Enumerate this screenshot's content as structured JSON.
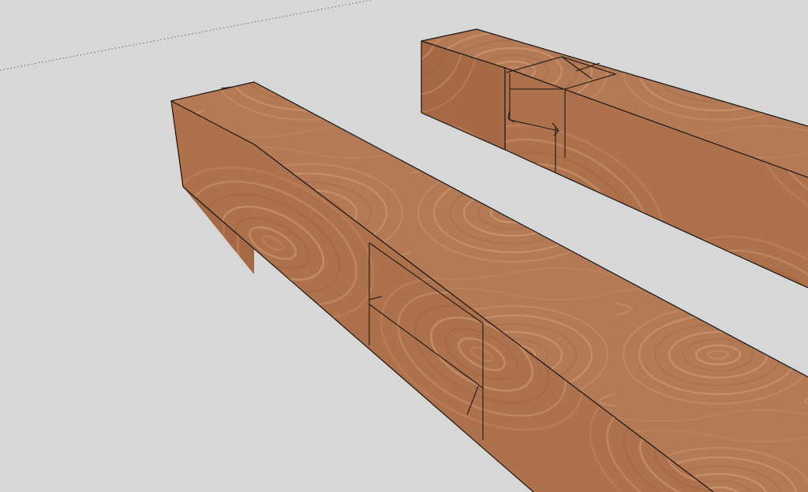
{
  "viewport": {
    "background_color": "#d7d7d7",
    "edge_color": "#141414",
    "axis_color": "#6a6a6a"
  },
  "materials": {
    "wood": {
      "top_face_color": "#b47a55",
      "front_face_color": "#ab7049",
      "end_face_color": "#a56a45",
      "grain_light": "#d6a27a",
      "grain_dark": "#8f5634"
    }
  },
  "model": {
    "objects": [
      {
        "name": "front-timber-beam",
        "joint": "mortise"
      },
      {
        "name": "back-timber-beam",
        "joint": "mortise"
      }
    ]
  }
}
